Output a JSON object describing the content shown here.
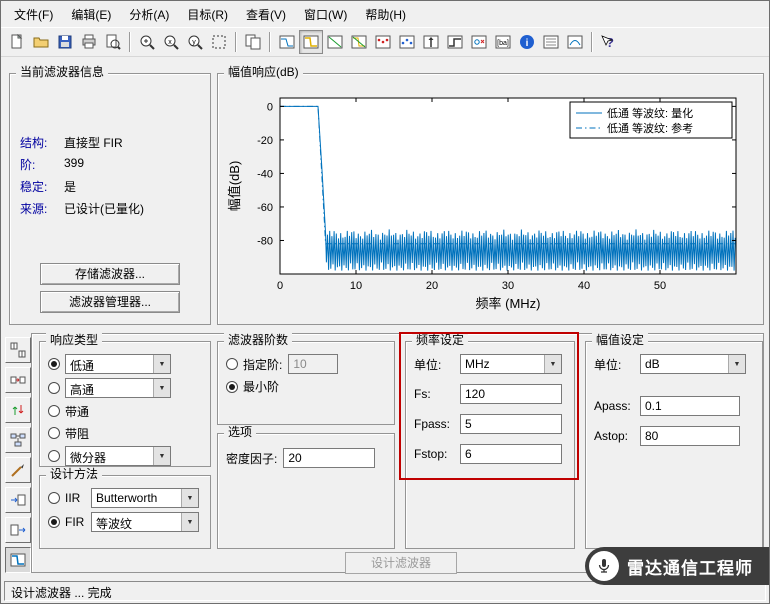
{
  "menu": {
    "items": [
      {
        "label": "文件(F)"
      },
      {
        "label": "编辑(E)"
      },
      {
        "label": "分析(A)"
      },
      {
        "label": "目标(R)"
      },
      {
        "label": "查看(V)"
      },
      {
        "label": "窗口(W)"
      },
      {
        "label": "帮助(H)"
      }
    ]
  },
  "toolbar": {
    "icons": [
      "new",
      "open",
      "save",
      "print",
      "print-preview",
      "zoom-in",
      "zoom-x",
      "zoom-y",
      "full-view",
      "tile",
      "filter-specs",
      "magnitude-response",
      "phase-response",
      "magnitude-phase",
      "group-delay",
      "phase-delay",
      "impulse-response",
      "step-response",
      "pole-zero",
      "coefficients",
      "filter-info",
      "magnitude-specs",
      "round-mode",
      "help"
    ],
    "active_icon": "magnitude-response"
  },
  "sidebar": {
    "icons": [
      "set-quantization",
      "transform-filter",
      "multirate-converter",
      "realize-model",
      "pole-zero-editor",
      "import-filter",
      "export-filter",
      "design-filter"
    ],
    "pressed_icon": "design-filter"
  },
  "current_filter_info": {
    "title": "当前滤波器信息",
    "fields": [
      {
        "label": "结构:",
        "value": "直接型 FIR"
      },
      {
        "label": "阶:",
        "value": "399"
      },
      {
        "label": "稳定:",
        "value": "是"
      },
      {
        "label": "来源:",
        "value": "已设计(已量化)"
      }
    ],
    "store_button": "存储滤波器...",
    "manager_button": "滤波器管理器..."
  },
  "magnitude_response_panel": {
    "title": "幅值响应(dB)"
  },
  "chart_data": {
    "type": "line",
    "title": "",
    "xlabel": "频率 (MHz)",
    "ylabel": "幅值(dB)",
    "xlim": [
      0,
      60
    ],
    "ylim": [
      -100,
      5
    ],
    "xticks": [
      0,
      10,
      20,
      30,
      40,
      50
    ],
    "yticks": [
      0,
      -20,
      -40,
      -60,
      -80
    ],
    "legend_position": "top-right",
    "grid": false,
    "legend": [
      {
        "label": "低通 等波纹: 量化",
        "style": "solid",
        "color": "#0072bd"
      },
      {
        "label": "低通 等波纹: 参考",
        "style": "dash-dot",
        "color": "#0072bd"
      }
    ],
    "response": {
      "passband_gain_db": 0,
      "fpass_mhz": 5,
      "fstop_mhz": 6,
      "stopband_atten_db": -80,
      "nyquist_mhz": 60,
      "fs_mhz": 120
    }
  },
  "response_type": {
    "title": "响应类型",
    "options": [
      {
        "label": "低通",
        "selected": true,
        "has_dropdown": true
      },
      {
        "label": "高通",
        "selected": false,
        "has_dropdown": true
      },
      {
        "label": "带通",
        "selected": false,
        "has_dropdown": false
      },
      {
        "label": "带阻",
        "selected": false,
        "has_dropdown": false
      },
      {
        "label": "微分器",
        "selected": false,
        "has_dropdown": true
      }
    ]
  },
  "design_method": {
    "title": "设计方法",
    "iir_label": "IIR",
    "iir_value": "Butterworth",
    "iir_selected": false,
    "fir_label": "FIR",
    "fir_value": "等波纹",
    "fir_selected": true
  },
  "filter_order": {
    "title": "滤波器阶数",
    "specify_label": "指定阶:",
    "specify_value": "10",
    "specify_selected": false,
    "minimum_label": "最小阶",
    "minimum_selected": true
  },
  "options_panel": {
    "title": "选项",
    "density_label": "密度因子:",
    "density_value": "20"
  },
  "frequency_specs": {
    "title": "频率设定",
    "unit_label": "单位:",
    "unit_value": "MHz",
    "fields": [
      {
        "label": "Fs:",
        "value": "120"
      },
      {
        "label": "Fpass:",
        "value": "5"
      },
      {
        "label": "Fstop:",
        "value": "6"
      }
    ]
  },
  "magnitude_specs": {
    "title": "幅值设定",
    "unit_label": "单位:",
    "unit_value": "dB",
    "fields": [
      {
        "label": "Apass:",
        "value": "0.1"
      },
      {
        "label": "Astop:",
        "value": "80"
      }
    ]
  },
  "design_button": "设计滤波器",
  "statusbar": {
    "text": "设计滤波器 ... 完成"
  },
  "watermark": {
    "text": "雷达通信工程师"
  }
}
